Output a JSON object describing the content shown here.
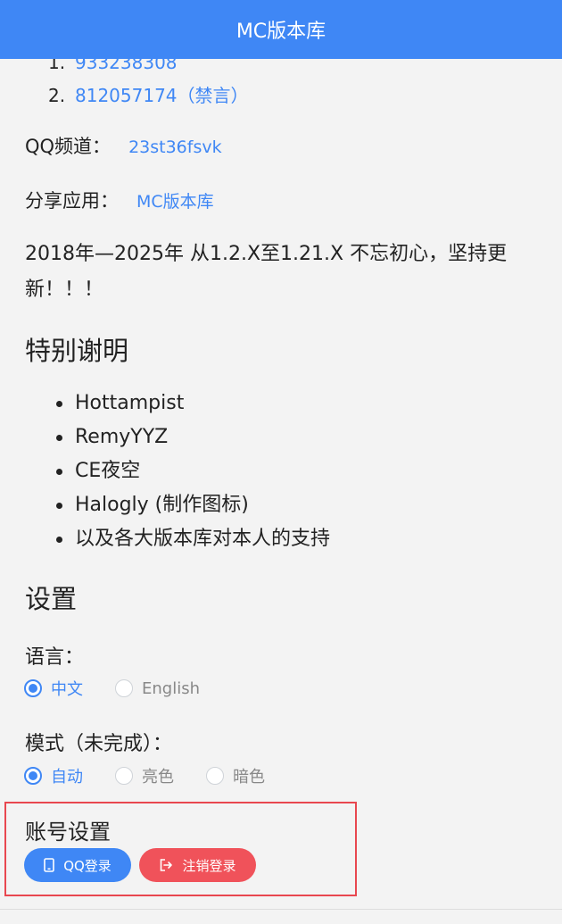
{
  "header": {
    "title": "MC版本库"
  },
  "groups": [
    {
      "num": "1.",
      "value": "933238308"
    },
    {
      "num": "2.",
      "value": "812057174（禁言）"
    }
  ],
  "qq_channel": {
    "label": "QQ频道：",
    "value": "23st36fsvk"
  },
  "share_app": {
    "label": "分享应用：",
    "value": "MC版本库"
  },
  "slogan": "2018年—2025年 从1.2.X至1.21.X 不忘初心，坚持更新！！！",
  "thanks": {
    "title": "特别谢明",
    "items": [
      "Hottampist",
      "RemyYYZ",
      "CE夜空",
      "Halogly (制作图标)",
      "以及各大版本库对本人的支持"
    ]
  },
  "settings": {
    "title": "设置",
    "language": {
      "label": "语言：",
      "options": [
        "中文",
        "English"
      ],
      "selected": "中文"
    },
    "mode": {
      "label": "模式（未完成）：",
      "options": [
        "自动",
        "亮色",
        "暗色"
      ],
      "selected": "自动"
    }
  },
  "account": {
    "title": "账号设置",
    "qq_login_label": "QQ登录",
    "logout_label": "注销登录",
    "icons": {
      "qq_login": "phone-icon",
      "logout": "logout-icon"
    }
  },
  "colors": {
    "primary": "#3f87f5",
    "danger": "#f0525a",
    "highlight_border": "#e8474f",
    "background": "#f3f3f3"
  }
}
